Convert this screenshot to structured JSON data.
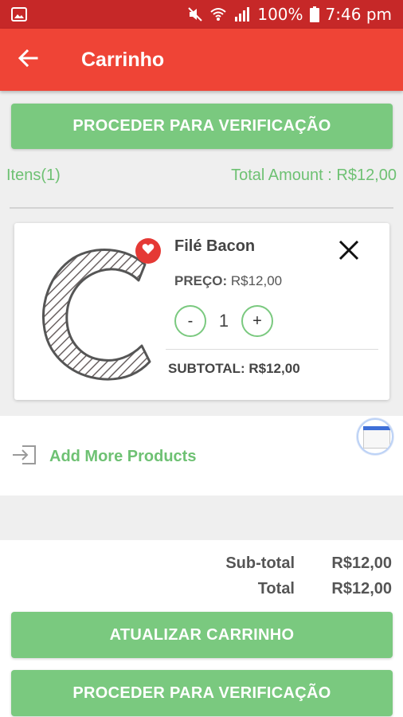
{
  "status_bar": {
    "battery": "100%",
    "time": "7:46 pm",
    "icons": [
      "image-icon",
      "mute-icon",
      "wifi-icon",
      "signal-icon",
      "battery-icon"
    ]
  },
  "app_bar": {
    "title": "Carrinho",
    "back_icon": "arrow-left-icon",
    "color": "#ef4436"
  },
  "top_checkout_button": "PROCEDER PARA VERIFICAÇÃO",
  "cart_info": {
    "items_label": "Itens(1)",
    "total_amount": "Total Amount : R$12,00"
  },
  "cart_items": [
    {
      "name": "Filé Bacon",
      "price_label": "PREÇO:",
      "price_value": "R$12,00",
      "quantity": "1",
      "decrement": "-",
      "increment": "+",
      "subtotal_label": "SUBTOTAL:",
      "subtotal_value": "R$12,00"
    }
  ],
  "add_more": {
    "label": "Add More Products"
  },
  "totals": {
    "subtotal_label": "Sub-total",
    "subtotal_value": "R$12,00",
    "total_label": "Total",
    "total_value": "R$12,00"
  },
  "buttons": {
    "update_cart": "ATUALIZAR CARRINHO",
    "checkout": "PROCEDER PARA VERIFICAÇÃO"
  },
  "colors": {
    "accent_green": "#7ac97f",
    "header_red": "#ef4436",
    "status_red": "#c62828"
  }
}
